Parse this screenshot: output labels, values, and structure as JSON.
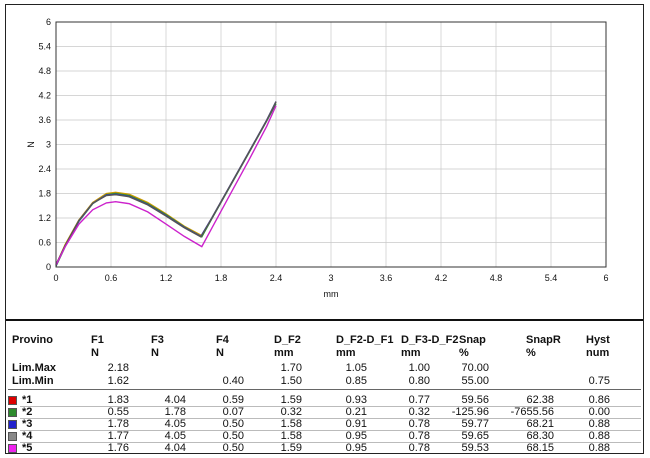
{
  "chart_data": {
    "type": "line",
    "xlabel": "mm",
    "ylabel": "N",
    "xlim": [
      0,
      6
    ],
    "ylim": [
      0,
      6
    ],
    "xticks": [
      "0",
      "0.6",
      "1.2",
      "1.8",
      "2.4",
      "3",
      "3.6",
      "4.2",
      "4.8",
      "5.4",
      "6"
    ],
    "yticks": [
      "0",
      "0.6",
      "1.2",
      "1.8",
      "2.4",
      "3",
      "3.6",
      "4.2",
      "4.8",
      "5.4",
      "6"
    ],
    "grid": true,
    "series": [
      {
        "name": "*1",
        "color": "#cc9900",
        "points": [
          [
            0,
            0.05
          ],
          [
            0.1,
            0.55
          ],
          [
            0.25,
            1.15
          ],
          [
            0.4,
            1.58
          ],
          [
            0.55,
            1.8
          ],
          [
            0.65,
            1.83
          ],
          [
            0.8,
            1.78
          ],
          [
            1.0,
            1.58
          ],
          [
            1.2,
            1.3
          ],
          [
            1.4,
            1.0
          ],
          [
            1.59,
            0.77
          ],
          [
            1.7,
            1.2
          ],
          [
            1.9,
            2.0
          ],
          [
            2.1,
            2.8
          ],
          [
            2.3,
            3.6
          ],
          [
            2.4,
            4.04
          ]
        ]
      },
      {
        "name": "*2",
        "color": "#2e8b2e",
        "points": [
          [
            0,
            0.02
          ],
          [
            0.1,
            0.5
          ],
          [
            0.25,
            1.12
          ],
          [
            0.4,
            1.55
          ],
          [
            0.55,
            1.77
          ],
          [
            0.65,
            1.8
          ],
          [
            0.8,
            1.75
          ],
          [
            1.0,
            1.55
          ],
          [
            1.2,
            1.28
          ],
          [
            1.4,
            0.98
          ],
          [
            1.59,
            0.74
          ],
          [
            1.7,
            1.18
          ],
          [
            1.9,
            1.98
          ],
          [
            2.1,
            2.78
          ],
          [
            2.3,
            3.58
          ],
          [
            2.4,
            4.0
          ]
        ]
      },
      {
        "name": "*3",
        "color": "#3333cc",
        "points": [
          [
            0,
            0.04
          ],
          [
            0.1,
            0.52
          ],
          [
            0.25,
            1.13
          ],
          [
            0.4,
            1.56
          ],
          [
            0.55,
            1.76
          ],
          [
            0.66,
            1.78
          ],
          [
            0.8,
            1.73
          ],
          [
            1.0,
            1.53
          ],
          [
            1.2,
            1.26
          ],
          [
            1.4,
            0.97
          ],
          [
            1.58,
            0.75
          ],
          [
            1.7,
            1.2
          ],
          [
            1.9,
            2.0
          ],
          [
            2.1,
            2.8
          ],
          [
            2.3,
            3.6
          ],
          [
            2.4,
            4.05
          ]
        ]
      },
      {
        "name": "*4",
        "color": "#555555",
        "points": [
          [
            0,
            0.06
          ],
          [
            0.1,
            0.53
          ],
          [
            0.25,
            1.14
          ],
          [
            0.4,
            1.56
          ],
          [
            0.55,
            1.75
          ],
          [
            0.65,
            1.77
          ],
          [
            0.8,
            1.72
          ],
          [
            1.0,
            1.52
          ],
          [
            1.2,
            1.25
          ],
          [
            1.4,
            0.96
          ],
          [
            1.58,
            0.74
          ],
          [
            1.7,
            1.19
          ],
          [
            1.9,
            1.99
          ],
          [
            2.1,
            2.79
          ],
          [
            2.3,
            3.59
          ],
          [
            2.4,
            4.05
          ]
        ]
      },
      {
        "name": "*5",
        "color": "#cc22cc",
        "points": [
          [
            0,
            0.05
          ],
          [
            0.1,
            0.5
          ],
          [
            0.25,
            1.05
          ],
          [
            0.4,
            1.4
          ],
          [
            0.55,
            1.57
          ],
          [
            0.65,
            1.6
          ],
          [
            0.8,
            1.55
          ],
          [
            1.0,
            1.35
          ],
          [
            1.2,
            1.05
          ],
          [
            1.4,
            0.75
          ],
          [
            1.59,
            0.5
          ],
          [
            1.7,
            0.95
          ],
          [
            1.9,
            1.78
          ],
          [
            2.1,
            2.6
          ],
          [
            2.3,
            3.45
          ],
          [
            2.4,
            3.95
          ]
        ]
      }
    ]
  },
  "table": {
    "headers": [
      {
        "l1": "Provino",
        "l2": ""
      },
      {
        "l1": "F1",
        "l2": "N"
      },
      {
        "l1": "F3",
        "l2": "N"
      },
      {
        "l1": "F4",
        "l2": "N"
      },
      {
        "l1": "D_F2",
        "l2": "mm"
      },
      {
        "l1": "D_F2-D_F1",
        "l2": "mm"
      },
      {
        "l1": "D_F3-D_F2",
        "l2": "mm"
      },
      {
        "l1": "Snap",
        "l2": "%"
      },
      {
        "l1": "SnapR",
        "l2": "%"
      },
      {
        "l1": "Hyst",
        "l2": "num"
      }
    ],
    "limits": [
      {
        "label": "Lim.Max",
        "values": [
          "2.18",
          "",
          "",
          "1.70",
          "1.05",
          "1.00",
          "70.00",
          "",
          ""
        ]
      },
      {
        "label": "Lim.Min",
        "values": [
          "1.62",
          "",
          "0.40",
          "1.50",
          "0.85",
          "0.80",
          "55.00",
          "",
          "0.75"
        ]
      }
    ],
    "rows": [
      {
        "id": "*1",
        "color": "#dd0000",
        "values": [
          "1.83",
          "4.04",
          "0.59",
          "1.59",
          "0.93",
          "0.77",
          "59.56",
          "62.38",
          "0.86"
        ]
      },
      {
        "id": "*2",
        "color": "#2e8b2e",
        "values": [
          "0.55",
          "1.78",
          "0.07",
          "0.32",
          "0.21",
          "0.32",
          "-125.96",
          "-7655.56",
          "0.00"
        ]
      },
      {
        "id": "*3",
        "color": "#2222cc",
        "values": [
          "1.78",
          "4.05",
          "0.50",
          "1.58",
          "0.91",
          "0.78",
          "59.77",
          "68.21",
          "0.88"
        ]
      },
      {
        "id": "*4",
        "color": "#888888",
        "values": [
          "1.77",
          "4.05",
          "0.50",
          "1.58",
          "0.95",
          "0.78",
          "59.65",
          "68.30",
          "0.88"
        ]
      },
      {
        "id": "*5",
        "color": "#ee22ee",
        "values": [
          "1.76",
          "4.04",
          "0.50",
          "1.59",
          "0.95",
          "0.78",
          "59.53",
          "68.15",
          "0.88"
        ]
      }
    ]
  }
}
